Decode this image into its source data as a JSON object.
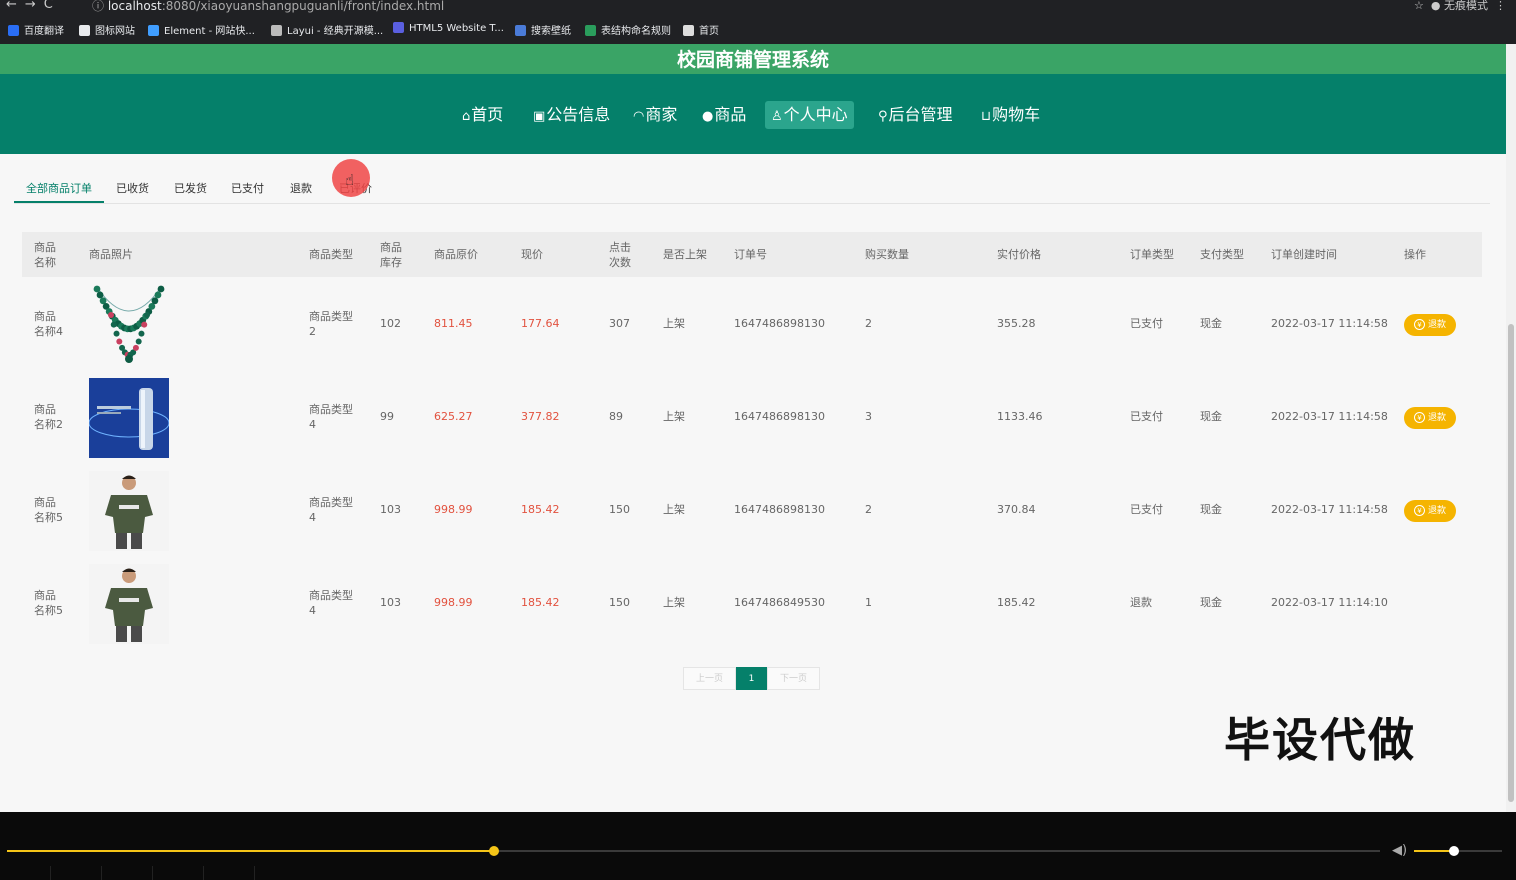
{
  "browser": {
    "url_host": "localhost",
    "url_rest": ":8080/xiaoyuanshangpuguanli/front/index.html",
    "profile": "无痕模式",
    "bookmarks": [
      {
        "label": "百度翻译",
        "icon": "translate-icon",
        "color": "#2a6ef5"
      },
      {
        "label": "图标网站",
        "icon": "bookmark-icon",
        "color": "#e8eaed"
      },
      {
        "label": "Element - 网站快...",
        "icon": "element-icon",
        "color": "#409eff"
      },
      {
        "label": "Layui - 经典开源模...",
        "icon": "layui-icon",
        "color": "#bbbbbb"
      },
      {
        "label": "HTML5 Website T...",
        "icon": "html5-icon",
        "color": "#5a5fe0"
      },
      {
        "label": "搜索壁纸",
        "icon": "wallpaper-icon",
        "color": "#4a7bd8"
      },
      {
        "label": "表结构命名规则",
        "icon": "sheet-icon",
        "color": "#2a9d5c"
      },
      {
        "label": "首页",
        "icon": "globe-icon",
        "color": "#dddddd"
      }
    ]
  },
  "site": {
    "title": "校园商铺管理系统",
    "nav": [
      {
        "label": "首页",
        "icon": "⌂"
      },
      {
        "label": "公告信息",
        "icon": "▣"
      },
      {
        "label": "商家",
        "icon": "◠"
      },
      {
        "label": "商品",
        "icon": "●"
      },
      {
        "label": "个人中心",
        "icon": "♙"
      },
      {
        "label": "后台管理",
        "icon": "⚲"
      },
      {
        "label": "购物车",
        "icon": "⊔"
      }
    ],
    "active_nav": "个人中心"
  },
  "tabs": [
    "全部商品订单",
    "已收货",
    "已发货",
    "已支付",
    "退款",
    "已评价"
  ],
  "table": {
    "headers": [
      "商品\n名称",
      "商品照片",
      "商品类型",
      "商品\n库存",
      "商品原价",
      "现价",
      "点击\n次数",
      "是否上架",
      "订单号",
      "购买数量",
      "实付价格",
      "订单类型",
      "支付类型",
      "订单创建时间",
      "操作"
    ],
    "rows": [
      {
        "name": "商品\n名称4",
        "image": "necklace",
        "type": "商品类型\n2",
        "stock": "102",
        "orig": "811.45",
        "price": "177.64",
        "clicks": "307",
        "shelf": "上架",
        "order_no": "1647486898130",
        "qty": "2",
        "paid": "355.28",
        "order_type": "已支付",
        "pay_type": "现金",
        "created": "2022-03-17 11:14:58",
        "action": "退款"
      },
      {
        "name": "商品\n名称2",
        "image": "bottle",
        "type": "商品类型\n4",
        "stock": "99",
        "orig": "625.27",
        "price": "377.82",
        "clicks": "89",
        "shelf": "上架",
        "order_no": "1647486898130",
        "qty": "3",
        "paid": "1133.46",
        "order_type": "已支付",
        "pay_type": "现金",
        "created": "2022-03-17 11:14:58",
        "action": "退款"
      },
      {
        "name": "商品\n名称5",
        "image": "tshirt",
        "type": "商品类型\n4",
        "stock": "103",
        "orig": "998.99",
        "price": "185.42",
        "clicks": "150",
        "shelf": "上架",
        "order_no": "1647486898130",
        "qty": "2",
        "paid": "370.84",
        "order_type": "已支付",
        "pay_type": "现金",
        "created": "2022-03-17 11:14:58",
        "action": "退款"
      },
      {
        "name": "商品\n名称5",
        "image": "tshirt",
        "type": "商品类型\n4",
        "stock": "103",
        "orig": "998.99",
        "price": "185.42",
        "clicks": "150",
        "shelf": "上架",
        "order_no": "1647486849530",
        "qty": "1",
        "paid": "185.42",
        "order_type": "退款",
        "pay_type": "现金",
        "created": "2022-03-17 11:14:10",
        "action": ""
      }
    ]
  },
  "pager": {
    "prev": "上一页",
    "current": "1",
    "next": "下一页"
  },
  "watermark": "毕设代做",
  "player": {
    "progress": 0.355,
    "volume": 0.45
  }
}
